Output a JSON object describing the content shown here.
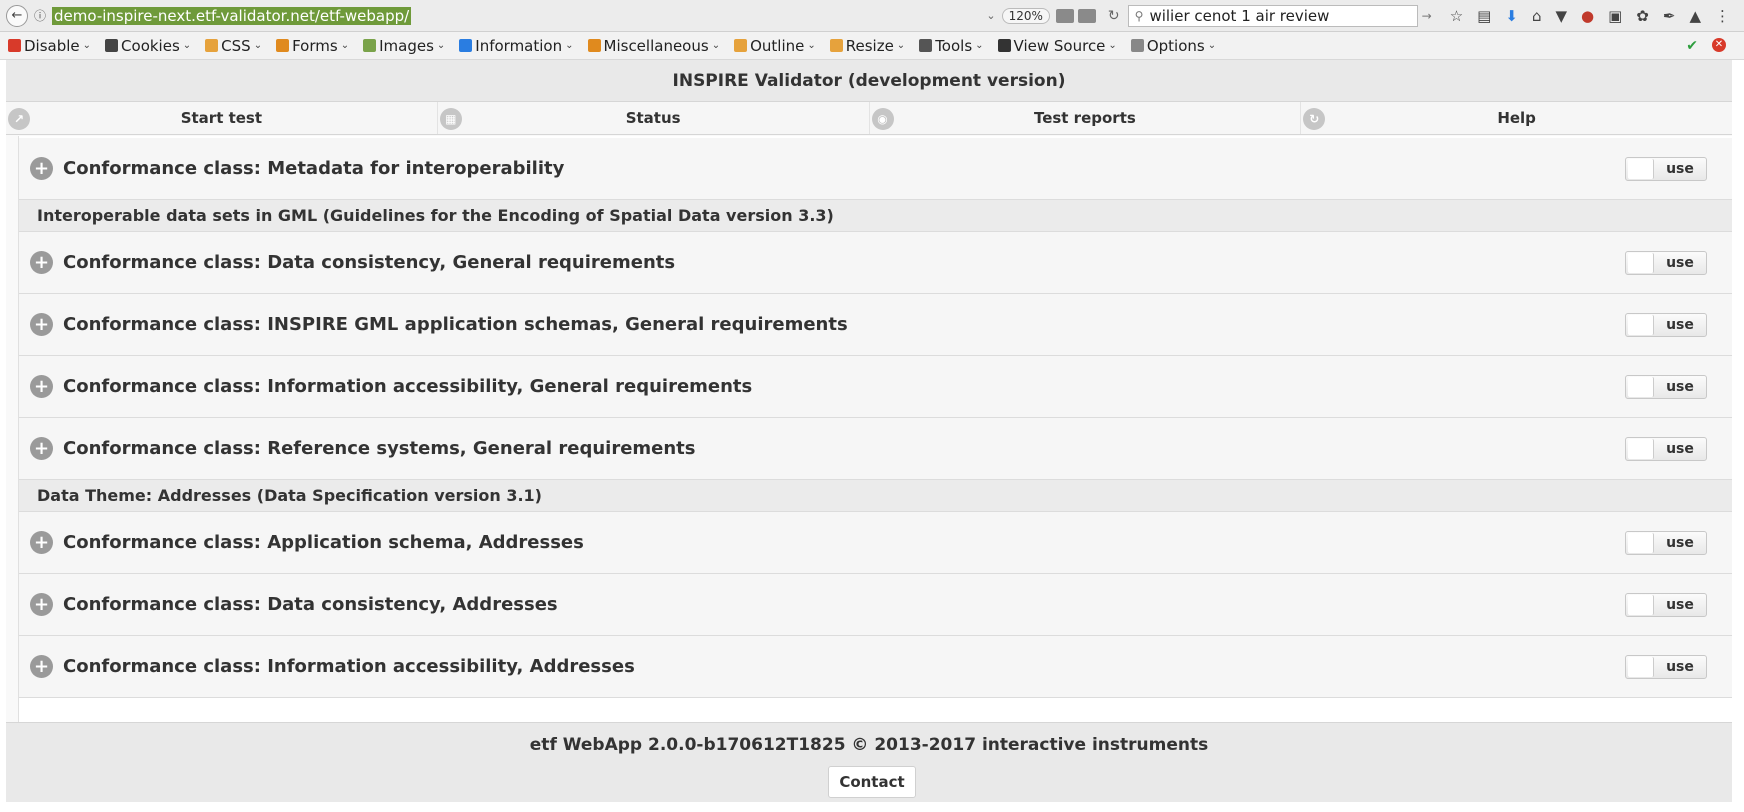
{
  "browser": {
    "url": "demo-inspire-next.etf-validator.net/etf-webapp/",
    "zoom": "120%",
    "search": "wilier cenot 1 air review"
  },
  "devtoolbar": {
    "items": [
      {
        "label": "Disable",
        "color": "#d83a2a"
      },
      {
        "label": "Cookies",
        "color": "#444444"
      },
      {
        "label": "CSS",
        "color": "#e6a23c"
      },
      {
        "label": "Forms",
        "color": "#e08a1e"
      },
      {
        "label": "Images",
        "color": "#7aa34a"
      },
      {
        "label": "Information",
        "color": "#2a7de1"
      },
      {
        "label": "Miscellaneous",
        "color": "#e08a1e"
      },
      {
        "label": "Outline",
        "color": "#e6a23c"
      },
      {
        "label": "Resize",
        "color": "#e6a23c"
      },
      {
        "label": "Tools",
        "color": "#555555"
      },
      {
        "label": "View Source",
        "color": "#333333"
      },
      {
        "label": "Options",
        "color": "#888888"
      }
    ]
  },
  "app": {
    "title": "INSPIRE Validator (development version)",
    "nav": [
      {
        "label": "Start test",
        "icon": "share-icon"
      },
      {
        "label": "Status",
        "icon": "calendar-icon"
      },
      {
        "label": "Test reports",
        "icon": "eye-icon"
      },
      {
        "label": "Help",
        "icon": "refresh-icon"
      }
    ],
    "toggle_label": "use",
    "rows": [
      {
        "kind": "class",
        "label": "Conformance class: Metadata for interoperability"
      },
      {
        "kind": "section",
        "label": "Interoperable data sets in GML (Guidelines for the Encoding of Spatial Data version 3.3)"
      },
      {
        "kind": "class",
        "label": "Conformance class: Data consistency, General requirements"
      },
      {
        "kind": "class",
        "label": "Conformance class: INSPIRE GML application schemas, General requirements"
      },
      {
        "kind": "class",
        "label": "Conformance class: Information accessibility, General requirements"
      },
      {
        "kind": "class",
        "label": "Conformance class: Reference systems, General requirements"
      },
      {
        "kind": "section",
        "label": "Data Theme: Addresses (Data Specification version 3.1)"
      },
      {
        "kind": "class",
        "label": "Conformance class: Application schema, Addresses"
      },
      {
        "kind": "class",
        "label": "Conformance class: Data consistency, Addresses"
      },
      {
        "kind": "class",
        "label": "Conformance class: Information accessibility, Addresses"
      }
    ],
    "footer": "etf WebApp 2.0.0-b170612T1825 © 2013-2017 interactive instruments",
    "contact": "Contact"
  }
}
